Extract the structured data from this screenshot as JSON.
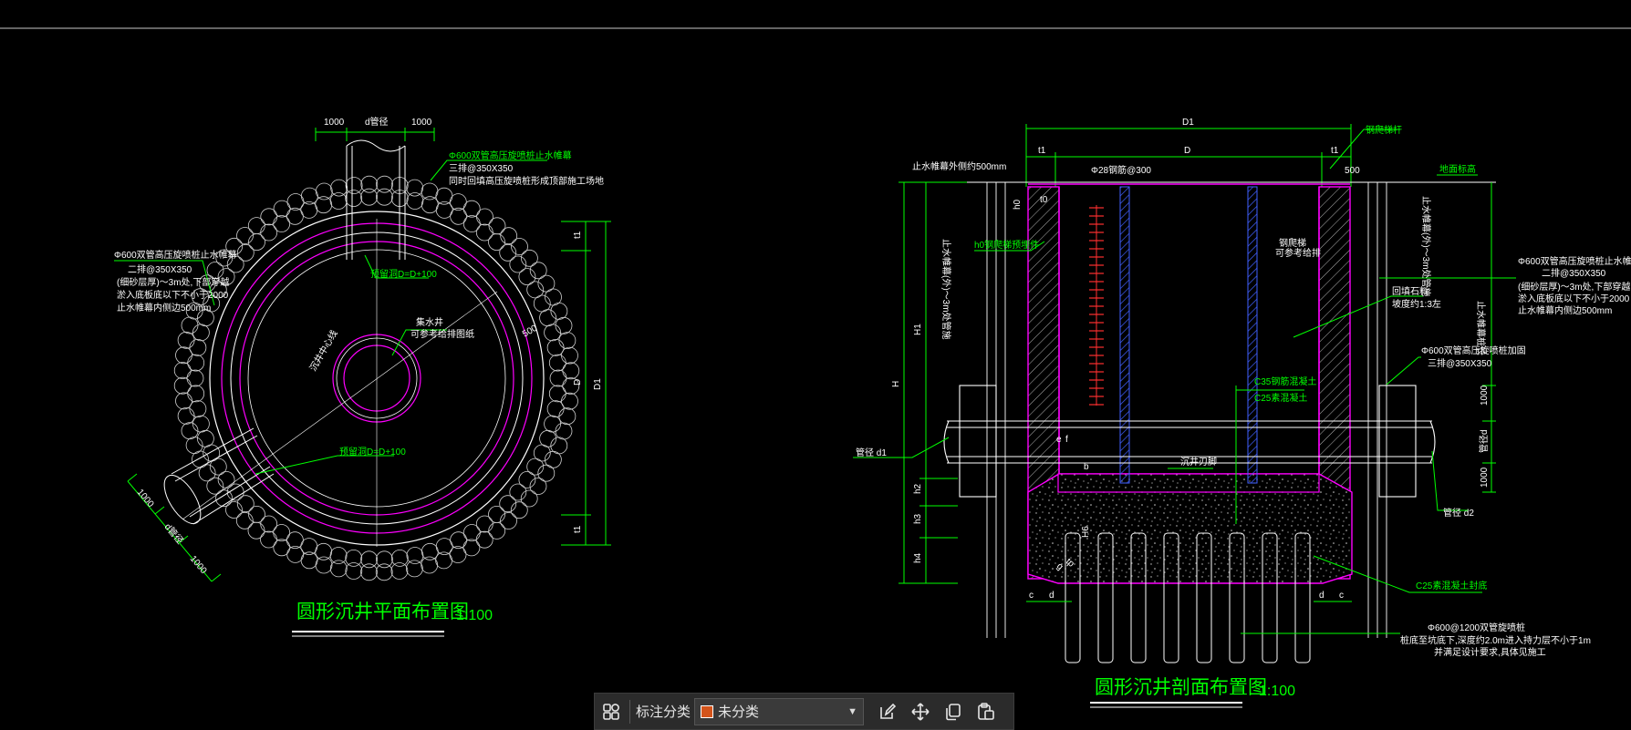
{
  "plan": {
    "title": "圆形沉井平面布置图",
    "scale": "1:100",
    "labels": {
      "dim_1000_left": "1000",
      "dim_d_top": "d管径",
      "dim_1000_right": "1000",
      "top_note_1": "Φ600双管高压旋喷桩止水帷幕",
      "top_note_2": "三排@350X350",
      "top_note_3": "同时回填高压旋喷桩形成顶部施工场地",
      "left_note_1": "Φ600双管高压旋喷桩止水帷幕",
      "left_note_2": "二排@350X350",
      "left_note_3": "(细砂层厚)～3m处,下部穿越",
      "left_note_4": "淤入底板底以下不小于2000",
      "left_note_5": "止水帷幕内侧边500mm",
      "pipe_hole_top": "预留洞D=D+100",
      "pipe_hole_bottom": "预留洞D=D+100",
      "center_note_1": "集水井",
      "center_note_2": "可参考给排图纸",
      "diag_label": "沉井中心线",
      "dim_500": "500",
      "dim_t1_top": "t1",
      "dim_D": "D",
      "dim_D1": "D1",
      "dim_t1_bottom": "t1",
      "dim_1000_bl": "1000",
      "dim_d_bl": "d管径",
      "dim_1000_bl2": "1000"
    }
  },
  "section": {
    "title": "圆形沉井剖面布置图",
    "scale": "1:100",
    "labels": {
      "D1": "D1",
      "D": "D",
      "t1_left": "t1",
      "t1_right": "t1",
      "anchor": "钢爬梯杆",
      "ground_left": "止水帷幕外侧约500mm",
      "dim_500": "500",
      "ground_right": "地面标高",
      "rebar_top": "Φ28钢筋@300",
      "t0": "t0",
      "h0": "h0",
      "ladder": "h0钢爬梯预埋件",
      "vert_left_1": "止水帷幕(外)～3m处管施",
      "vert_right_1": "止水帷幕(外)～3m处管施",
      "right_note_1": "Φ600双管高压旋喷桩止水帷幕",
      "right_note_2": "二排@350X350",
      "right_note_3": "(细砂层厚)～3m处,下部穿越",
      "right_note_4": "淤入底板底以下不小于2000",
      "right_note_5": "止水帷幕内侧边500mm",
      "slope_1": "回填石料",
      "slope_2": "坡度约1:3左",
      "inner_1": "钢爬梯",
      "inner_2": "可参考给排",
      "c35": "C35钢筋混凝土",
      "c25a": "C25素混凝土",
      "pipe_right_1": "Φ600双管高压旋喷桩加固",
      "pipe_right_2": "三排@350X350",
      "H": "H",
      "H1": "H1",
      "h2": "h2",
      "h3": "h3",
      "h4": "h4",
      "pipe_left": "管径 d1",
      "pipe_right": "管径 d2",
      "dim_1000_a": "1000",
      "dim_d": "管径d",
      "dim_1000_b": "1000",
      "e": "e",
      "f": "f",
      "b": "b",
      "bottom_label": "沉井刃脚",
      "c25b": "C25素混凝土封底",
      "c_left": "c",
      "d_left": "d",
      "d_right": "d",
      "c_right": "c",
      "piles_1": "Φ600@1200双管旋喷桩",
      "piles_2": "桩底至坑底下,深度约2.0m进入持力层不小于1m",
      "piles_3": "并满足设计要求,具体见施工",
      "ins_1": "止水帷幕桩长",
      "H6": "H6",
      "g": "g",
      "tp": "tp"
    }
  },
  "toolbar": {
    "label": "标注分类",
    "dropdown_value": "未分类",
    "dropdown_color": "#d4541b"
  },
  "colors": {
    "background": "#000000",
    "green": "#00ff00",
    "magenta": "#ff00ff",
    "white": "#ffffff",
    "red": "#ff3030",
    "blue": "#4060ff"
  }
}
